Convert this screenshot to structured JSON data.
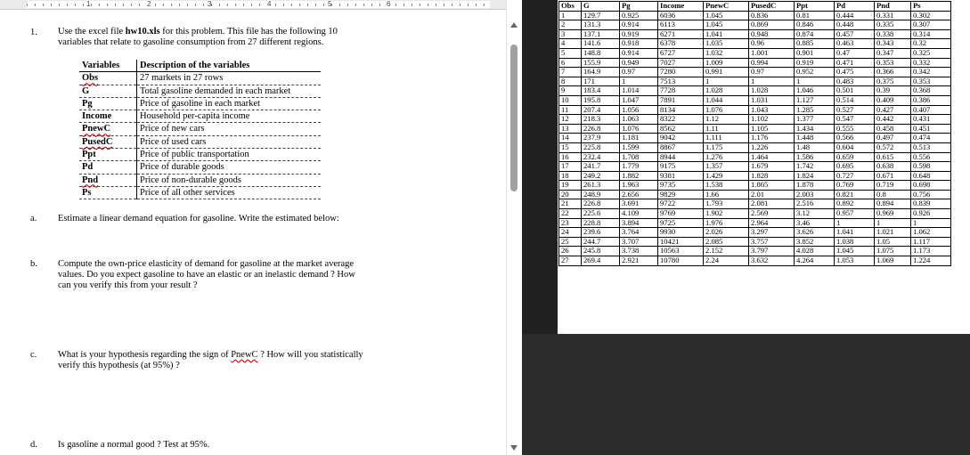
{
  "ruler": {
    "numbers": [
      "1",
      "2",
      "3",
      "4",
      "5",
      "6"
    ]
  },
  "question1": {
    "number": "1.",
    "text_pre": "Use the excel file ",
    "filename": "hw10.xls",
    "text_post": " for this problem.  This file has the following 10",
    "line2": "variables that relate to gasoline consumption from 27 different regions."
  },
  "variables_table": {
    "headers": [
      "Variables",
      "Description of the variables"
    ],
    "rows": [
      [
        "Obs",
        "27 markets in 27 rows"
      ],
      [
        "G",
        "Total gasoline demanded in each market"
      ],
      [
        "Pg",
        "Price of gasoline in each market"
      ],
      [
        "Income",
        "Household per-capita income"
      ],
      [
        "PnewC",
        "Price of new cars"
      ],
      [
        "PusedC",
        "Price of used cars"
      ],
      [
        "Ppt",
        "Price of public transportation"
      ],
      [
        "Pd",
        "Price of durable goods"
      ],
      [
        "Pnd",
        "Price of non-durable goods"
      ],
      [
        "Ps",
        "Price of all other services"
      ]
    ]
  },
  "sub_a": {
    "label": "a.",
    "text": "Estimate a linear demand equation for gasoline.  Write the estimated below:"
  },
  "sub_b": {
    "label": "b.",
    "lines": [
      "Compute the own-price elasticity of demand for gasoline at the market average",
      "values.  Do you expect gasoline to have an elastic or an inelastic demand ?  How",
      "can you verify this from your result ?"
    ]
  },
  "sub_c": {
    "label": "c.",
    "line1_pre": "What is your hypothesis regarding the sign of ",
    "line1_word": "PnewC",
    "line1_post": " ? How will you statistically",
    "line2": "verify this hypothesis (at 95%) ?"
  },
  "sub_d": {
    "label": "d.",
    "text": "Is gasoline a normal good ?  Test at 95%."
  },
  "data_table": {
    "headers": [
      "Obs",
      "G",
      "Pg",
      "Income",
      "PnewC",
      "PusedC",
      "Ppt",
      "Pd",
      "Pnd",
      "Ps"
    ],
    "rows": [
      [
        "1",
        "129.7",
        "0.925",
        "6036",
        "1.045",
        "0.836",
        "0.81",
        "0.444",
        "0.331",
        "0.302"
      ],
      [
        "2",
        "131.3",
        "0.914",
        "6113",
        "1.045",
        "0.869",
        "0.846",
        "0.448",
        "0.335",
        "0.307"
      ],
      [
        "3",
        "137.1",
        "0.919",
        "6271",
        "1.041",
        "0.948",
        "0.874",
        "0.457",
        "0.338",
        "0.314"
      ],
      [
        "4",
        "141.6",
        "0.918",
        "6378",
        "1.035",
        "0.96",
        "0.885",
        "0.463",
        "0.343",
        "0.32"
      ],
      [
        "5",
        "148.8",
        "0.914",
        "6727",
        "1.032",
        "1.001",
        "0.901",
        "0.47",
        "0.347",
        "0.325"
      ],
      [
        "6",
        "155.9",
        "0.949",
        "7027",
        "1.009",
        "0.994",
        "0.919",
        "0.471",
        "0.353",
        "0.332"
      ],
      [
        "7",
        "164.9",
        "0.97",
        "7280",
        "0.991",
        "0.97",
        "0.952",
        "0.475",
        "0.366",
        "0.342"
      ],
      [
        "8",
        "171",
        "1",
        "7513",
        "1",
        "1",
        "1",
        "0.483",
        "0.375",
        "0.353"
      ],
      [
        "9",
        "183.4",
        "1.014",
        "7728",
        "1.028",
        "1.028",
        "1.046",
        "0.501",
        "0.39",
        "0.368"
      ],
      [
        "10",
        "195.8",
        "1.047",
        "7891",
        "1.044",
        "1.031",
        "1.127",
        "0.514",
        "0.409",
        "0.386"
      ],
      [
        "11",
        "207.4",
        "1.056",
        "8134",
        "1.076",
        "1.043",
        "1.285",
        "0.527",
        "0.427",
        "0.407"
      ],
      [
        "12",
        "218.3",
        "1.063",
        "8322",
        "1.12",
        "1.102",
        "1.377",
        "0.547",
        "0.442",
        "0.431"
      ],
      [
        "13",
        "226.8",
        "1.076",
        "8562",
        "1.11",
        "1.105",
        "1.434",
        "0.555",
        "0.458",
        "0.451"
      ],
      [
        "14",
        "237.9",
        "1.181",
        "9042",
        "1.111",
        "1.176",
        "1.448",
        "0.566",
        "0.497",
        "0.474"
      ],
      [
        "15",
        "225.8",
        "1.599",
        "8867",
        "1.175",
        "1.226",
        "1.48",
        "0.604",
        "0.572",
        "0.513"
      ],
      [
        "16",
        "232.4",
        "1.708",
        "8944",
        "1.276",
        "1.464",
        "1.586",
        "0.659",
        "0.615",
        "0.556"
      ],
      [
        "17",
        "241.7",
        "1.779",
        "9175",
        "1.357",
        "1.679",
        "1.742",
        "0.695",
        "0.638",
        "0.598"
      ],
      [
        "18",
        "249.2",
        "1.882",
        "9381",
        "1.429",
        "1.828",
        "1.824",
        "0.727",
        "0.671",
        "0.648"
      ],
      [
        "19",
        "261.3",
        "1.963",
        "9735",
        "1.538",
        "1.865",
        "1.878",
        "0.769",
        "0.719",
        "0.698"
      ],
      [
        "20",
        "248.9",
        "2.656",
        "9829",
        "1.66",
        "2.01",
        "2.003",
        "0.821",
        "0.8",
        "0.756"
      ],
      [
        "21",
        "226.8",
        "3.691",
        "9722",
        "1.793",
        "2.081",
        "2.516",
        "0.892",
        "0.894",
        "0.839"
      ],
      [
        "22",
        "225.6",
        "4.109",
        "9769",
        "1.902",
        "2.569",
        "3.12",
        "0.957",
        "0.969",
        "0.926"
      ],
      [
        "23",
        "228.8",
        "3.894",
        "9725",
        "1.976",
        "2.964",
        "3.46",
        "1",
        "1",
        "1"
      ],
      [
        "24",
        "239.6",
        "3.764",
        "9930",
        "2.026",
        "3.297",
        "3.626",
        "1.041",
        "1.021",
        "1.062"
      ],
      [
        "25",
        "244.7",
        "3.707",
        "10421",
        "2.085",
        "3.757",
        "3.852",
        "1.038",
        "1.05",
        "1.117"
      ],
      [
        "26",
        "245.8",
        "3.738",
        "10563",
        "2.152",
        "3.797",
        "4.028",
        "1.045",
        "1.075",
        "1.173"
      ],
      [
        "27",
        "269.4",
        "2.921",
        "10780",
        "2.24",
        "3.632",
        "4.264",
        "1.053",
        "1.069",
        "1.224"
      ]
    ]
  }
}
